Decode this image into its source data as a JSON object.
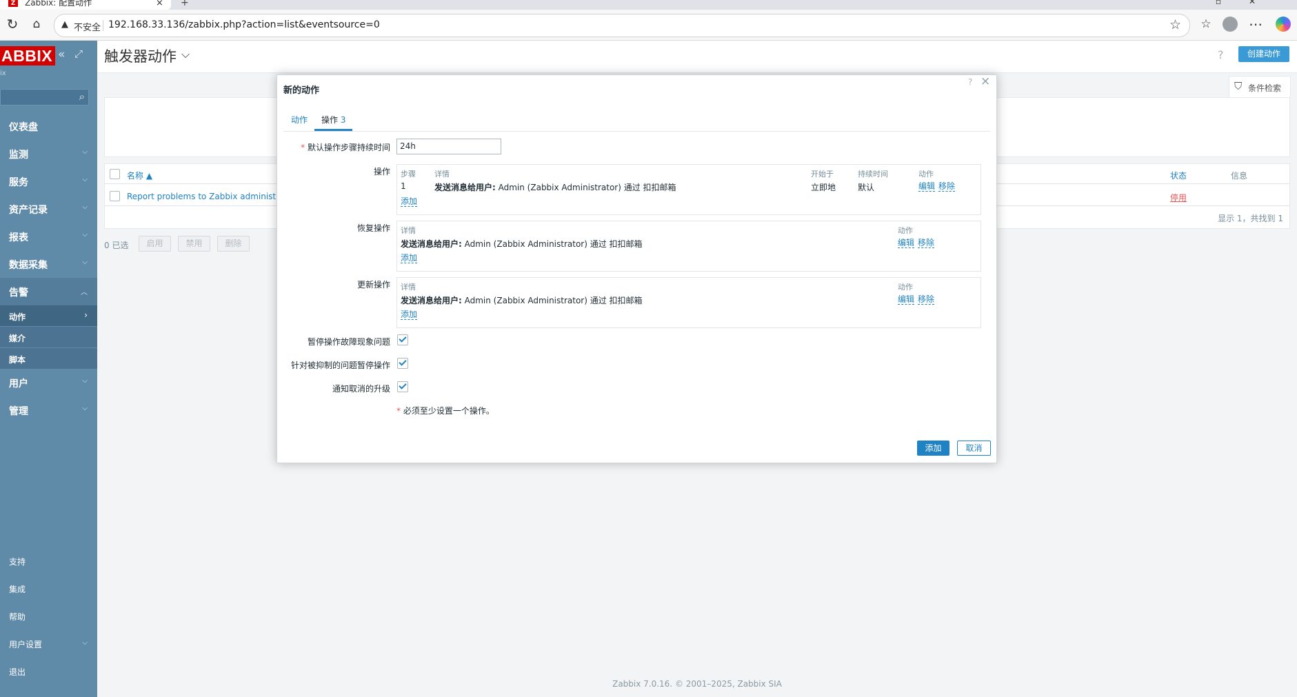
{
  "browser": {
    "tab_title": "Zabbix: 配置动作",
    "tab_close": "×",
    "new_tab": "+",
    "security_label": "不安全",
    "url": "192.168.33.136/zabbix.php?action=list&eventsource=0"
  },
  "sidebar": {
    "logo": "ABBIX",
    "version": "ix",
    "items": [
      {
        "label": "仪表盘"
      },
      {
        "label": "监测"
      },
      {
        "label": "服务"
      },
      {
        "label": "资产记录"
      },
      {
        "label": "报表"
      },
      {
        "label": "数据采集"
      },
      {
        "label": "告警"
      },
      {
        "label": "用户"
      },
      {
        "label": "管理"
      }
    ],
    "sub_items": [
      {
        "label": "动作"
      },
      {
        "label": "媒介"
      },
      {
        "label": "脚本"
      }
    ],
    "bottom_items": [
      {
        "label": "支持"
      },
      {
        "label": "集成"
      },
      {
        "label": "帮助"
      },
      {
        "label": "用户设置"
      },
      {
        "label": "退出"
      }
    ]
  },
  "page": {
    "title": "触发器动作",
    "help": "?",
    "create_button": "创建动作",
    "filter_label": "条件检索",
    "table": {
      "col_name": "名称 ▲",
      "col_status": "状态",
      "col_info": "信息",
      "rows": [
        {
          "name": "Report problems to Zabbix administrators",
          "status": "停用"
        }
      ],
      "paging": "显示 1，共找到 1"
    },
    "selected": "0 已选",
    "mass_buttons": [
      "启用",
      "禁用",
      "删除"
    ],
    "footer": "Zabbix 7.0.16. © 2001–2025, Zabbix SIA"
  },
  "modal": {
    "title": "新的动作",
    "help": "?",
    "close": "×",
    "tabs": [
      {
        "label": "动作"
      },
      {
        "label": "操作",
        "count": "3"
      }
    ],
    "default_duration": {
      "label": "默认操作步骤持续时间",
      "required": "*",
      "value": "24h"
    },
    "operations": {
      "label": "操作",
      "headers": {
        "step": "步骤",
        "details": "详情",
        "start": "开始于",
        "duration": "持续时间",
        "action": "动作"
      },
      "rows": [
        {
          "step": "1",
          "details_bold": "发送消息给用户:",
          "details": " Admin (Zabbix Administrator) 通过 扣扣邮箱",
          "start": "立即地",
          "duration": "默认",
          "edit": "编辑",
          "remove": "移除"
        }
      ],
      "add": "添加"
    },
    "recovery": {
      "label": "恢复操作",
      "headers": {
        "details": "详情",
        "action": "动作"
      },
      "rows": [
        {
          "details_bold": "发送消息给用户:",
          "details": " Admin (Zabbix Administrator) 通过 扣扣邮箱",
          "edit": "编辑",
          "remove": "移除"
        }
      ],
      "add": "添加"
    },
    "update": {
      "label": "更新操作",
      "headers": {
        "details": "详情",
        "action": "动作"
      },
      "rows": [
        {
          "details_bold": "发送消息给用户:",
          "details": " Admin (Zabbix Administrator) 通过 扣扣邮箱",
          "edit": "编辑",
          "remove": "移除"
        }
      ],
      "add": "添加"
    },
    "checkboxes": [
      {
        "label": "暂停操作故障现象问题",
        "checked": true
      },
      {
        "label": "针对被抑制的问题暂停操作",
        "checked": true
      },
      {
        "label": "通知取消的升级",
        "checked": true
      }
    ],
    "note_mark": "*",
    "note": " 必须至少设置一个操作。",
    "add_button": "添加",
    "cancel_button": "取消"
  }
}
